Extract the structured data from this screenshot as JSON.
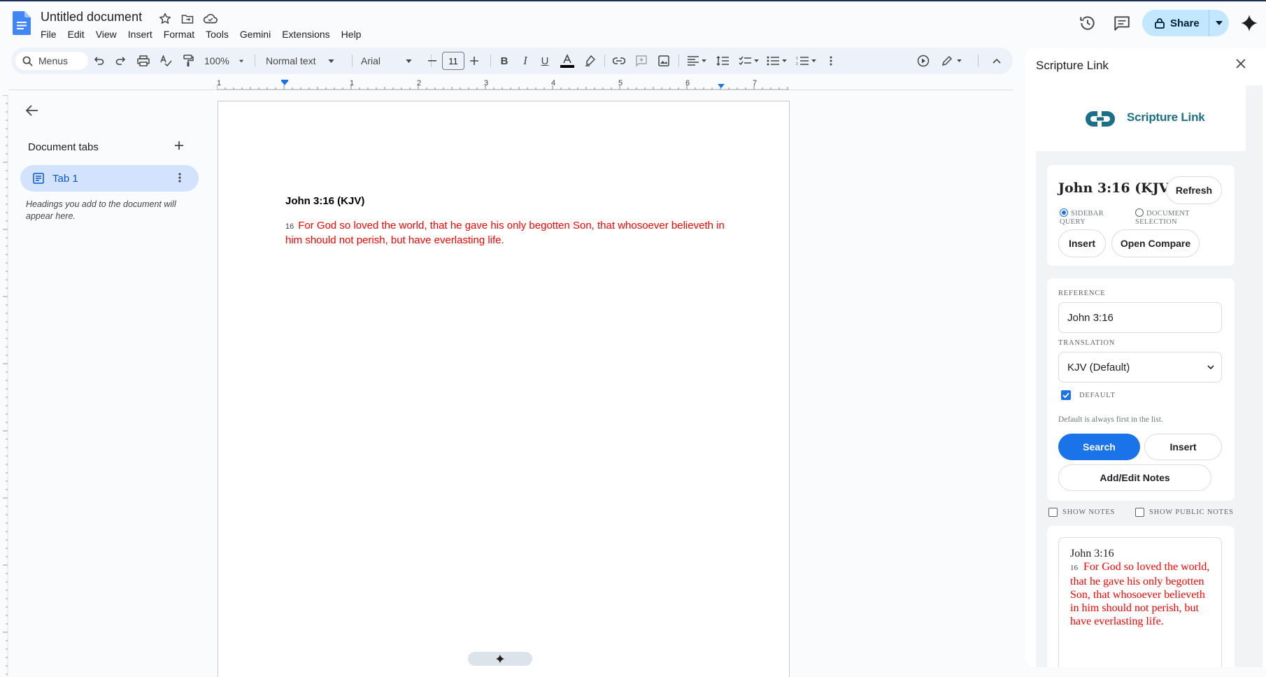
{
  "app": {
    "doc_title": "Untitled document",
    "menu": [
      "File",
      "Edit",
      "View",
      "Insert",
      "Format",
      "Tools",
      "Gemini",
      "Extensions",
      "Help"
    ],
    "share_label": "Share"
  },
  "toolbar": {
    "search_label": "Menus",
    "zoom": "100%",
    "style": "Normal text",
    "font": "Arial",
    "font_size": "11"
  },
  "ruler": {
    "marks": [
      "1",
      "1",
      "2",
      "3",
      "4",
      "5",
      "6",
      "7"
    ]
  },
  "tabs_panel": {
    "title": "Document tabs",
    "tab_label": "Tab 1",
    "hint": "Headings you add to the document will appear here."
  },
  "document": {
    "heading": "John 3:16 (KJV)",
    "verse_number": "16",
    "verse_text": "For God so loved the world, that he gave his only begotten Son, that whosoever believeth in him should not perish, but have everlasting life."
  },
  "sidepanel": {
    "title": "Scripture Link",
    "logo_text": "Scripture Link",
    "card1": {
      "heading": "John 3:16 (KJV)",
      "refresh_label": "Refresh",
      "radio1_label_line1": "SIDEBAR",
      "radio1_label_line2": "QUERY",
      "radio2_label_line1": "DOCUMENT",
      "radio2_label_line2": "SELECTION",
      "insert_label": "Insert",
      "compare_label": "Open Compare"
    },
    "card2": {
      "reference_label": "REFERENCE",
      "reference_value": "John 3:16",
      "translation_label": "TRANSLATION",
      "translation_value": "KJV (Default)",
      "default_label": "DEFAULT",
      "default_note": "Default is always first in the list.",
      "search_label": "Search",
      "insert_label": "Insert",
      "notes_label": "Add/Edit Notes"
    },
    "show_notes_label": "SHOW NOTES",
    "show_public_notes_label": "SHOW PUBLIC NOTES",
    "result": {
      "reference": "John 3:16",
      "verse_number": "16",
      "verse_text": "For God so loved the world, that he gave his only begotten Son, that whosoever believeth in him should not perish, but have everlasting life."
    }
  },
  "colors": {
    "accent": "#1a73e8",
    "verse_red": "#ff0000",
    "share_bg": "#c2e7ff",
    "tab_active_bg": "#d3e3fd"
  }
}
